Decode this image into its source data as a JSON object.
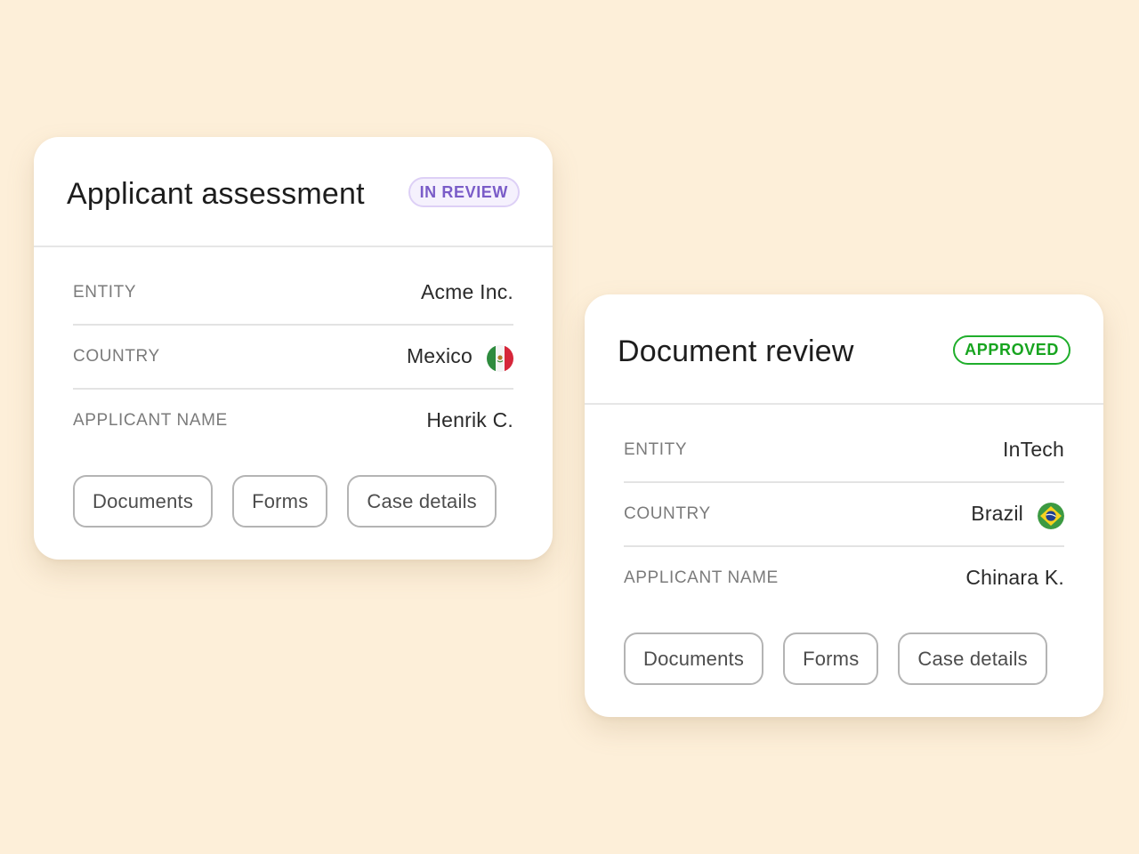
{
  "cards": [
    {
      "title": "Applicant assessment",
      "status": "IN REVIEW",
      "status_color": "#7a5cc8",
      "rows": [
        {
          "label": "ENTITY",
          "value": "Acme Inc."
        },
        {
          "label": "COUNTRY",
          "value": "Mexico",
          "icon": "mexico-flag-icon"
        },
        {
          "label": "APPLICANT NAME",
          "value": "Henrik C."
        }
      ],
      "buttons": [
        "Documents",
        "Forms",
        "Case details"
      ]
    },
    {
      "title": "Document review",
      "status": "APPROVED",
      "status_color": "#17a41f",
      "rows": [
        {
          "label": "ENTITY",
          "value": "InTech"
        },
        {
          "label": "COUNTRY",
          "value": "Brazil",
          "icon": "brazil-flag-icon"
        },
        {
          "label": "APPLICANT NAME",
          "value": "Chinara K."
        }
      ],
      "buttons": [
        "Documents",
        "Forms",
        "Case details"
      ]
    }
  ],
  "colors": {
    "background": "#fdefd9",
    "card": "#ffffff",
    "review_badge": "#7a5cc8",
    "approved_badge": "#17a41f"
  }
}
